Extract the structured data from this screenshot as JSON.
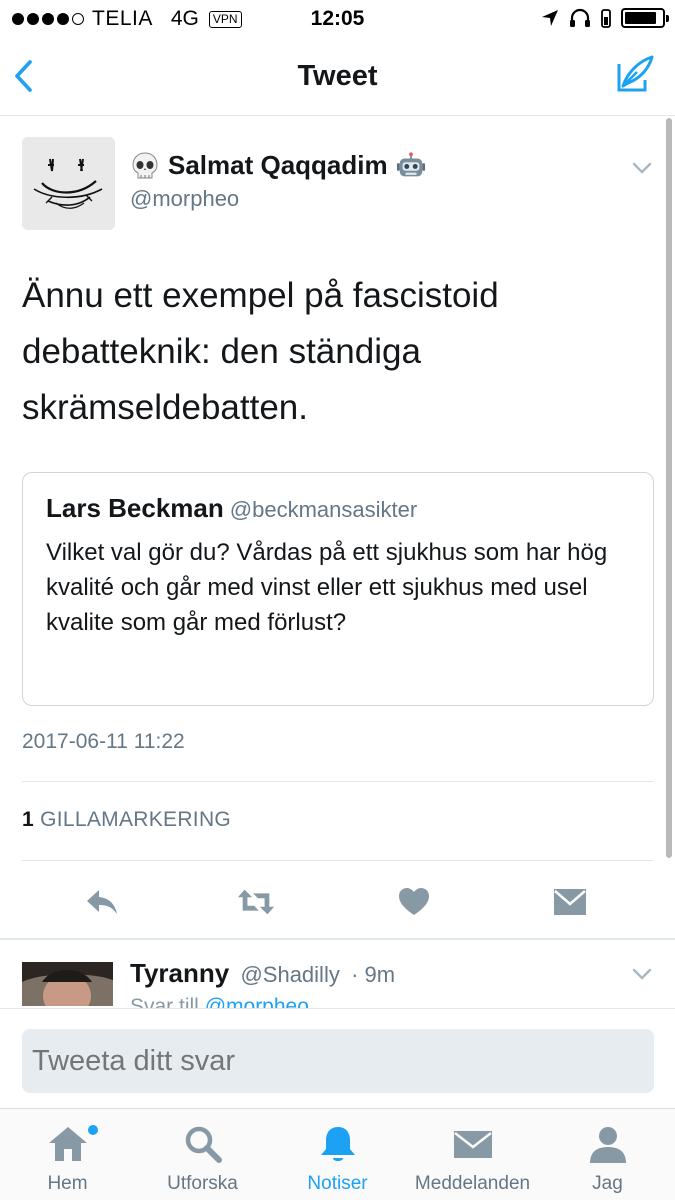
{
  "status_bar": {
    "carrier": "TELIA",
    "network": "4G",
    "vpn": "VPN",
    "time": "12:05"
  },
  "nav": {
    "title": "Tweet",
    "back_icon": "chevron-left-icon",
    "compose_icon": "compose-tweet-icon"
  },
  "tweet": {
    "author_emoji_left": "skull-emoji",
    "author_name": "Salmat Qaqqadim",
    "author_emoji_right": "robot-emoji",
    "author_handle": "@morpheo",
    "text": "Ännu ett exempel på fascistoid debatteknik: den ständiga skrämseldebatten.",
    "timestamp": "2017-06-11 11:22",
    "likes_count": "1",
    "likes_label": "GILLAMARKERING"
  },
  "quoted_tweet": {
    "author_name": "Lars Beckman",
    "author_handle": "@beckmansasikter",
    "text": "Vilket val gör du? Vårdas på ett sjukhus som har hög kvalité och går med vinst eller ett sjukhus med usel kvalite som går med förlust?"
  },
  "actions": [
    "reply-icon",
    "retweet-icon",
    "like-icon",
    "direct-message-icon"
  ],
  "reply_preview": {
    "author_name": "Tyranny",
    "author_handle": "@Shadilly",
    "age": "· 9m",
    "reply_to_prefix": "Svar till",
    "reply_to_handle": "@morpheo"
  },
  "composer": {
    "placeholder": "Tweeta ditt svar"
  },
  "tabs": [
    {
      "label": "Hem",
      "icon": "home-icon"
    },
    {
      "label": "Utforska",
      "icon": "search-icon"
    },
    {
      "label": "Notiser",
      "icon": "bell-icon"
    },
    {
      "label": "Meddelanden",
      "icon": "envelope-icon"
    },
    {
      "label": "Jag",
      "icon": "profile-icon"
    }
  ],
  "colors": {
    "accent": "#1da1f2",
    "secondary_text": "#657786",
    "icon_gray": "#8899a6"
  }
}
